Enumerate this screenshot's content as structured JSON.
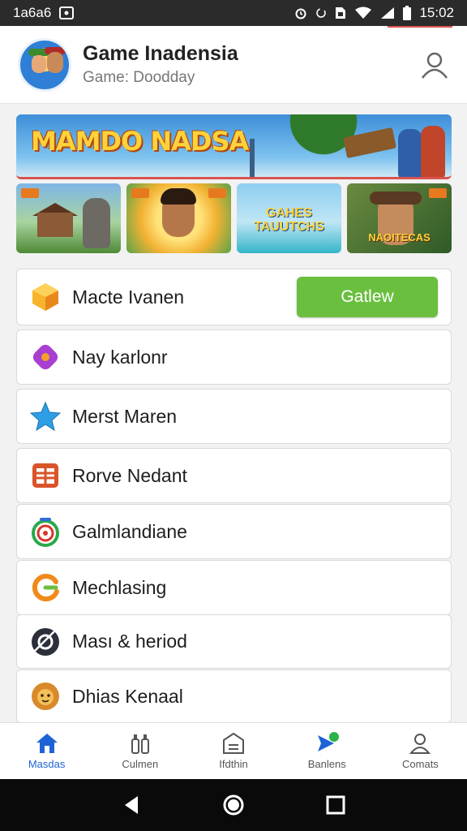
{
  "status_bar": {
    "time_left": "1a6a6",
    "time_right": "15:02",
    "icons_left": [
      "image-icon"
    ],
    "icons_right": [
      "alarm-icon",
      "sync-icon",
      "sim-icon",
      "wifi-icon",
      "signal-icon",
      "battery-icon"
    ]
  },
  "header": {
    "title": "Game Inadensia",
    "subtitle": "Game: Doodday",
    "avatar_icon": "game-characters-avatar",
    "action_icon": "user-icon"
  },
  "banner": {
    "title": "MAMDO NADSA"
  },
  "thumbnails": [
    {
      "text": ""
    },
    {
      "text": ""
    },
    {
      "text": "GAHES TAUUTCHS"
    },
    {
      "text": "NAOITECAS"
    }
  ],
  "list": {
    "items": [
      {
        "label": "Macte Ivanen",
        "icon": "orange-cube-icon",
        "color": "#f2a22b",
        "button": "Gatlew"
      },
      {
        "label": "Nay karlonr",
        "icon": "purple-puzzle-icon",
        "color": "#a83fd1"
      },
      {
        "label": "Merst Maren",
        "icon": "blue-star-icon",
        "color": "#2e9fe6"
      },
      {
        "label": "Rorve Nedant",
        "icon": "orange-grid-icon",
        "color": "#d9542a"
      },
      {
        "label": "Galmlandiane",
        "icon": "target-ring-icon",
        "color": "#2aa84a"
      },
      {
        "label": "Mechlasing",
        "icon": "orange-swirl-icon",
        "color": "#f08a1a"
      },
      {
        "label": "Ması & heriod",
        "icon": "dark-disc-icon",
        "color": "#2a2f3a"
      },
      {
        "label": "Dhias Kenaal",
        "icon": "lion-face-icon",
        "color": "#d88a2a"
      }
    ]
  },
  "bottom_nav": {
    "items": [
      {
        "label": "Masdas",
        "icon": "home-icon",
        "active": true
      },
      {
        "label": "Culmen",
        "icon": "bottles-icon",
        "active": false
      },
      {
        "label": "Ifdthin",
        "icon": "store-icon",
        "active": false
      },
      {
        "label": "Banlens",
        "icon": "send-badge-icon",
        "active": false
      },
      {
        "label": "Comats",
        "icon": "person-icon",
        "active": false
      }
    ]
  },
  "system_nav": {
    "icons": [
      "back-icon",
      "home-circle-icon",
      "recents-icon"
    ]
  },
  "colors": {
    "accent_blue": "#1e63d6",
    "primary_green": "#6abf3f",
    "banner_gold": "#ffd23a"
  }
}
